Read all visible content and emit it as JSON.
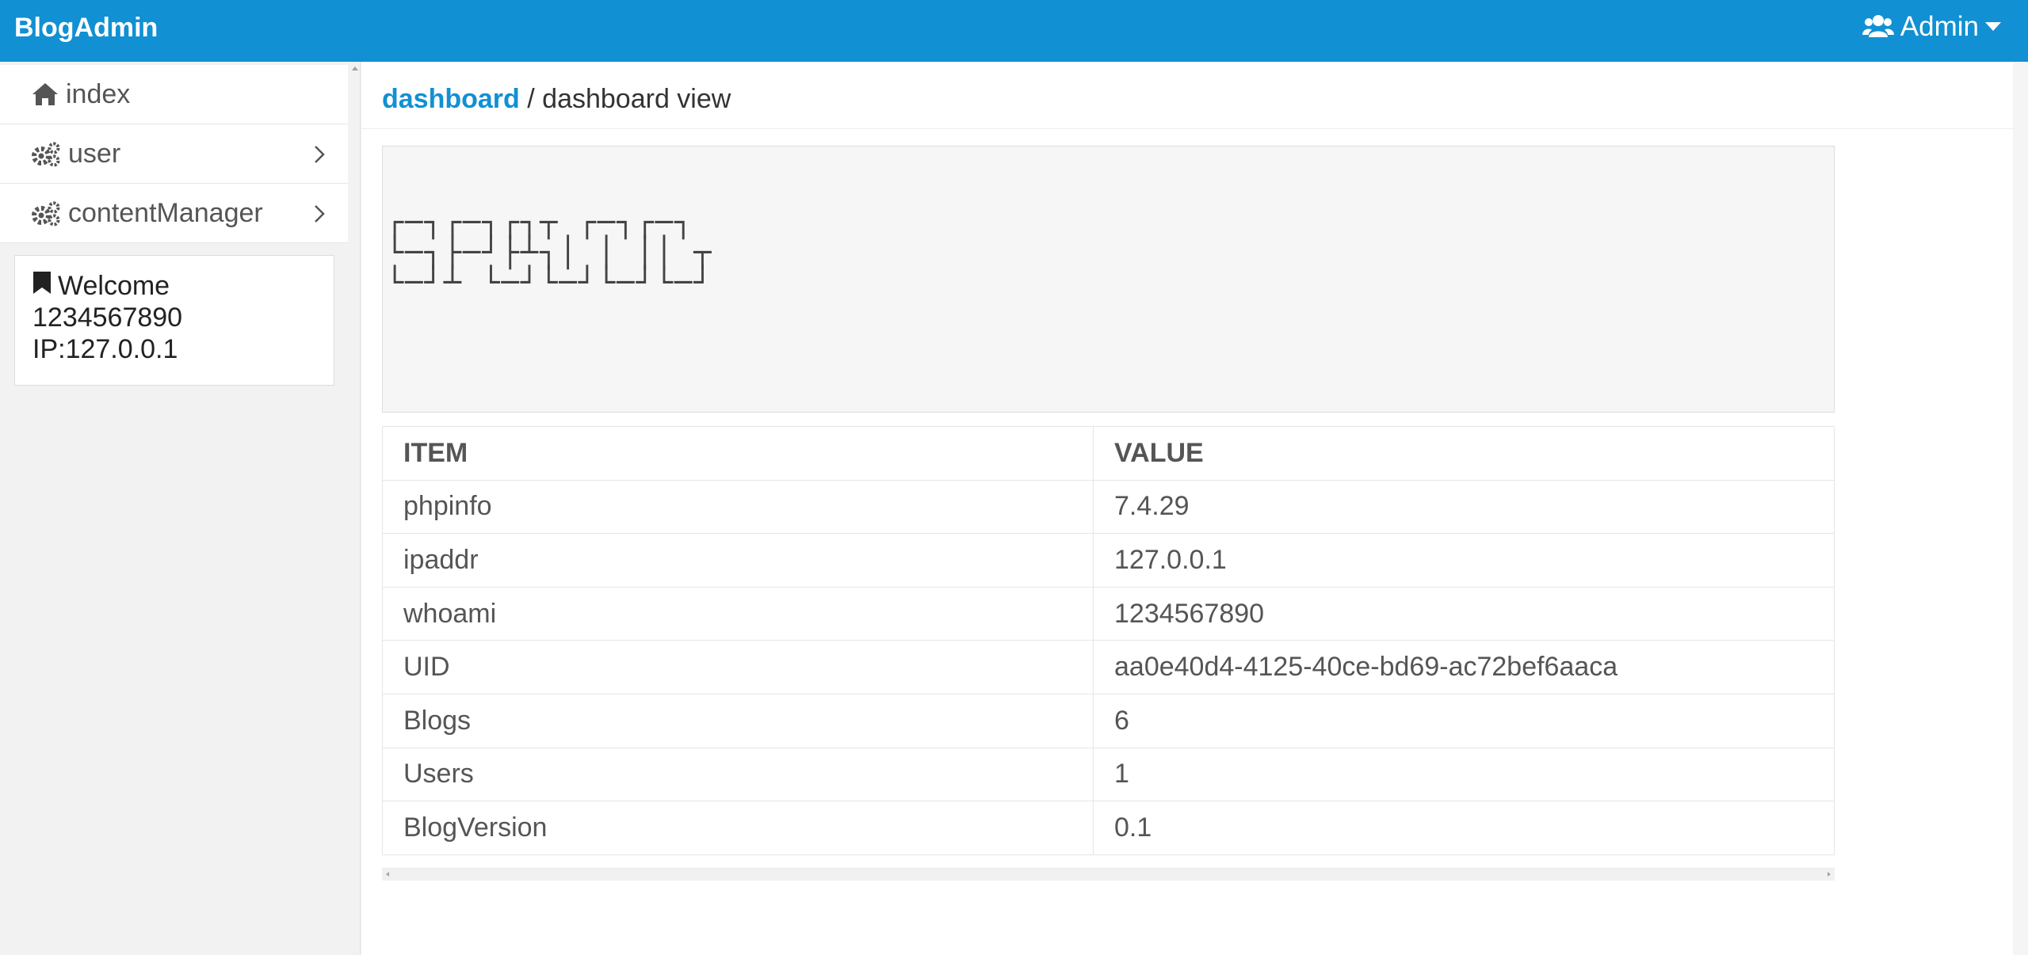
{
  "header": {
    "brand": "BlogAdmin",
    "user_menu_label": "Admin",
    "user_icon": "users-icon",
    "caret_icon": "caret-down-icon",
    "background_color": "#1190d3"
  },
  "sidebar": {
    "items": [
      {
        "label": "index",
        "icon": "home-icon",
        "has_submenu": false
      },
      {
        "label": "user",
        "icon": "gears-icon",
        "has_submenu": true
      },
      {
        "label": "contentManager",
        "icon": "gears-icon",
        "has_submenu": true
      }
    ],
    "welcome": {
      "icon": "bookmark-icon",
      "line1": "Welcome",
      "line2": "1234567890",
      "line3": "IP:127.0.0.1"
    }
  },
  "breadcrumb": {
    "link": "dashboard",
    "separator": "/",
    "current": "dashboard view"
  },
  "banner": {
    "ascii_art": "┌─┐┌─┐┌┐┬ ┌─┐┌─┐\n└─┐├─┘├┴┐│ │ ││ ┬\n└─┘┴ └─┘└─┘└─┘└─┘"
  },
  "info_table": {
    "headers": [
      "ITEM",
      "VALUE"
    ],
    "rows": [
      {
        "item": "phpinfo",
        "value": "7.4.29"
      },
      {
        "item": "ipaddr",
        "value": "127.0.0.1"
      },
      {
        "item": "whoami",
        "value": "1234567890"
      },
      {
        "item": "UID",
        "value": "aa0e40d4-4125-40ce-bd69-ac72bef6aaca"
      },
      {
        "item": "Blogs",
        "value": "6"
      },
      {
        "item": "Users",
        "value": "1"
      },
      {
        "item": "BlogVersion",
        "value": "0.1"
      }
    ]
  }
}
